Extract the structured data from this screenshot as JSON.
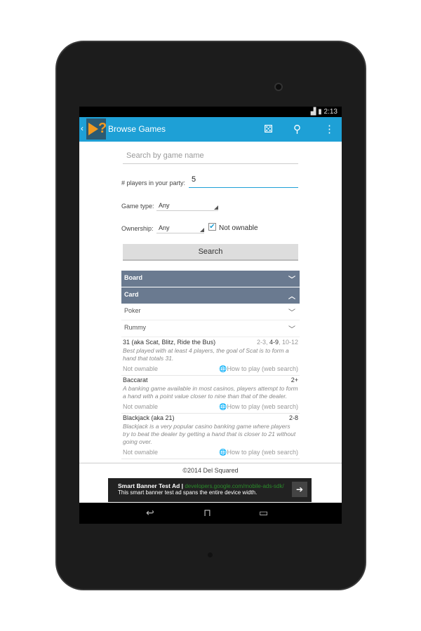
{
  "status": {
    "time": "2:13"
  },
  "actionbar": {
    "title": "Browse Games",
    "icons": [
      "dice-icon",
      "search-icon",
      "overflow-menu-icon"
    ]
  },
  "search": {
    "placeholder": "Search by game name"
  },
  "players": {
    "label": "# players in your party:",
    "value": "5"
  },
  "game_type": {
    "label": "Game type:",
    "value": "Any"
  },
  "ownership": {
    "label": "Ownership:",
    "value": "Any",
    "not_ownable_label": "Not ownable",
    "not_ownable_checked": true
  },
  "search_button": "Search",
  "categories": [
    {
      "label": "Board",
      "expanded": false
    },
    {
      "label": "Card",
      "expanded": true
    }
  ],
  "subcategories": [
    {
      "label": "Poker"
    },
    {
      "label": "Rummy"
    }
  ],
  "games": [
    {
      "name": "31 (aka Scat, Blitz, Ride the Bus)",
      "players": [
        "2-3, ",
        "4-9",
        ", 10-12"
      ],
      "desc": "Best played with at least 4 players, the goal of Scat is to form a hand that totals 31.",
      "own": "Not ownable",
      "how": "How to play (web search)"
    },
    {
      "name": "Baccarat",
      "players": [
        "",
        "2+",
        ""
      ],
      "desc": "A banking game available in most casinos, players attempt to form a hand with a point value closer to nine than that of the dealer.",
      "own": "Not ownable",
      "how": "How to play (web search)"
    },
    {
      "name": "Blackjack (aka 21)",
      "players": [
        "",
        "2-8",
        ""
      ],
      "desc": "Blackjack is a very popular casino banking game where players try to beat the dealer by getting a hand that is closer to 21 without going over.",
      "own": "Not ownable",
      "how": "How to play (web search)"
    }
  ],
  "footer": "©2014 Del Squared",
  "ad": {
    "title": "Smart Banner Test Ad |",
    "link": "developers.google.com/mobile-ads-sdk/",
    "text": "This smart banner test ad spans the entire device width."
  },
  "colors": {
    "actionbar": "#1ea0d6",
    "category": "#6a7a90"
  }
}
